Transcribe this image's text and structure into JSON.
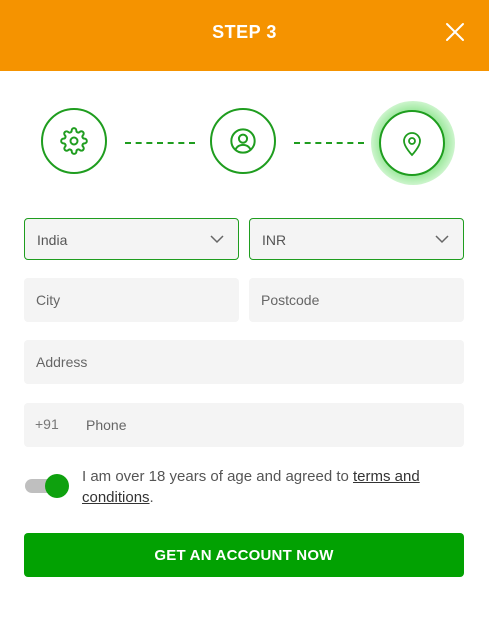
{
  "header": {
    "title": "STEP 3"
  },
  "steps": [
    {
      "icon": "gear-icon",
      "state": "complete"
    },
    {
      "icon": "user-icon",
      "state": "complete"
    },
    {
      "icon": "location-pin-icon",
      "state": "active"
    }
  ],
  "form": {
    "country": {
      "value": "India"
    },
    "currency": {
      "value": "INR"
    },
    "city": {
      "placeholder": "City"
    },
    "postcode": {
      "placeholder": "Postcode"
    },
    "address": {
      "placeholder": "Address"
    },
    "phone": {
      "prefix": "+91",
      "placeholder": "Phone"
    }
  },
  "consent": {
    "checked": true,
    "text_before": "I am over 18 years of age and agreed to ",
    "link_text": "terms and conditions",
    "text_after": "."
  },
  "submit": {
    "label": "GET AN ACCOUNT NOW"
  },
  "colors": {
    "header": "#f59300",
    "accent": "#1f9d1f",
    "button": "#02a102"
  }
}
